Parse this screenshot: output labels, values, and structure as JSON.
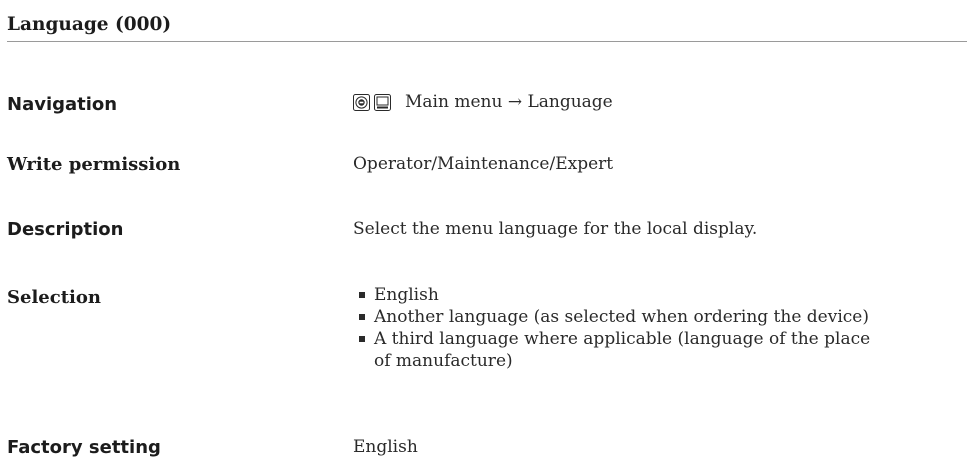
{
  "section": {
    "title": "Language (000)"
  },
  "navigation": {
    "label": "Navigation",
    "icons": [
      "operating-tool-icon",
      "display-menu-icon"
    ],
    "path": "Main menu → Language"
  },
  "write_permission": {
    "label": "Write permission",
    "value": "Operator/Maintenance/Expert"
  },
  "description": {
    "label": "Description",
    "value": "Select the menu language for the local display."
  },
  "selection": {
    "label": "Selection",
    "items": [
      {
        "line1": "English"
      },
      {
        "line1": "Another language (as selected when ordering the device)"
      },
      {
        "line1": "A third language where applicable (language of the place",
        "line2": "of manufacture)"
      }
    ]
  },
  "factory_setting": {
    "label": "Factory setting",
    "value": "English"
  }
}
